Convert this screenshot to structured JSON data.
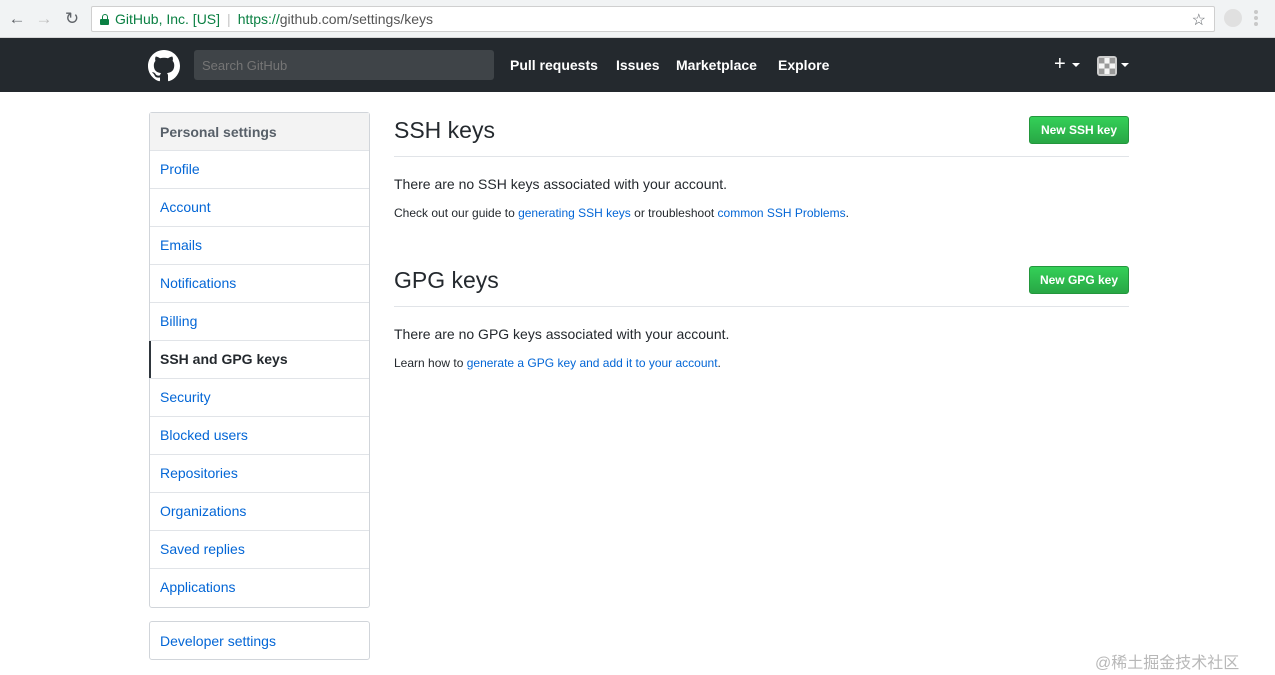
{
  "browser": {
    "org": "GitHub, Inc. [US]",
    "url_proto": "https://",
    "url_rest": "github.com/settings/keys"
  },
  "header": {
    "search_placeholder": "Search GitHub",
    "nav": [
      "Pull requests",
      "Issues",
      "Marketplace",
      "Explore"
    ],
    "plus_label": "+"
  },
  "sidebar": {
    "title": "Personal settings",
    "items": [
      {
        "label": "Profile"
      },
      {
        "label": "Account"
      },
      {
        "label": "Emails"
      },
      {
        "label": "Notifications"
      },
      {
        "label": "Billing"
      },
      {
        "label": "SSH and GPG keys"
      },
      {
        "label": "Security"
      },
      {
        "label": "Blocked users"
      },
      {
        "label": "Repositories"
      },
      {
        "label": "Organizations"
      },
      {
        "label": "Saved replies"
      },
      {
        "label": "Applications"
      }
    ],
    "selected": "SSH and GPG keys",
    "developer_settings": "Developer settings"
  },
  "ssh": {
    "title": "SSH keys",
    "button": "New SSH key",
    "empty_message": "There are no SSH keys associated with your account.",
    "help_prefix": "Check out our guide to ",
    "help_link1": "generating SSH keys",
    "help_mid": " or troubleshoot ",
    "help_link2": "common SSH Problems",
    "help_suffix": "."
  },
  "gpg": {
    "title": "GPG keys",
    "button": "New GPG key",
    "empty_message": "There are no GPG keys associated with your account.",
    "help_prefix": "Learn how to ",
    "help_link": "generate a GPG key and add it to your account",
    "help_suffix": "."
  },
  "watermark": "@稀土掘金技术社区",
  "colors": {
    "header_bg": "#24292e",
    "link": "#0366d6",
    "button_green": "#28a745",
    "secure_green": "#0b8043"
  }
}
